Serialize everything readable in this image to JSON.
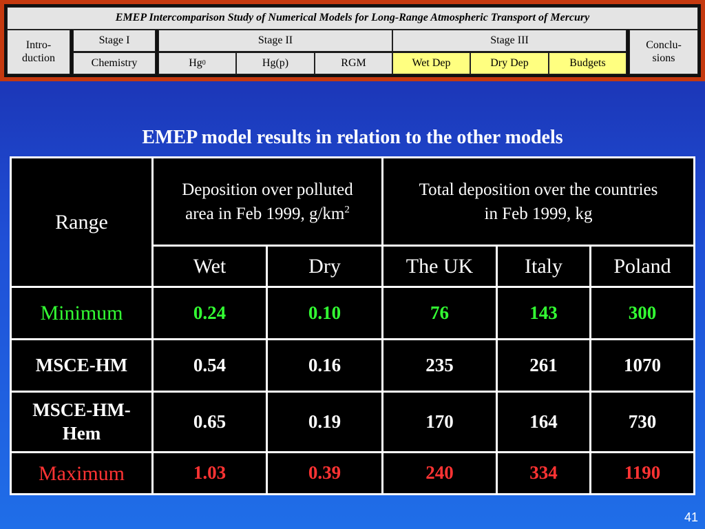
{
  "nav": {
    "title": "EMEP Intercomparison Study of Numerical Models for Long-Range Atmospheric Transport of Mercury",
    "intro": "Intro-duction",
    "stage1": "Stage I",
    "stage2": "Stage II",
    "stage3": "Stage III",
    "conclusions": "Conclu-sions",
    "chemistry": "Chemistry",
    "hg0_base": "Hg",
    "hg0_sup": "0",
    "hgp": "Hg(p)",
    "rgm": "RGM",
    "wet_dep": "Wet Dep",
    "dry_dep": "Dry Dep",
    "budgets": "Budgets",
    "active_color": "#ffff80",
    "frame_color": "#c5390f"
  },
  "heading": "EMEP model results in relation to the other models",
  "table": {
    "range_header": "Range",
    "deposition_header": "Deposition over polluted area in Feb 1999, g/km",
    "deposition_header_sup": "2",
    "total_header": "Total deposition over the countries in Feb 1999, kg",
    "columns": [
      "Wet",
      "Dry",
      "The UK",
      "Italy",
      "Poland"
    ],
    "rows": [
      {
        "label": "Minimum",
        "values": [
          "0.24",
          "0.10",
          "76",
          "143",
          "300"
        ],
        "color": "#33ff33"
      },
      {
        "label": "MSCE-HM",
        "values": [
          "0.54",
          "0.16",
          "235",
          "261",
          "1070"
        ],
        "color": "#ffffff"
      },
      {
        "label": "MSCE-HM-Hem",
        "values": [
          "0.65",
          "0.19",
          "170",
          "164",
          "730"
        ],
        "color": "#ffffff"
      },
      {
        "label": "Maximum",
        "values": [
          "1.03",
          "0.39",
          "240",
          "334",
          "1190"
        ],
        "color": "#ff3333"
      }
    ]
  },
  "page_number": "41"
}
